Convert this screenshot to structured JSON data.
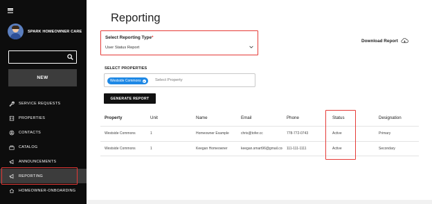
{
  "sidebar": {
    "brand_name": "SPARK HOMEOWNER CARE",
    "search_value": "",
    "new_label": "NEW",
    "items": [
      {
        "label": "SERVICE REQUESTS",
        "icon": "wrench-icon"
      },
      {
        "label": "PROPERTIES",
        "icon": "building-icon"
      },
      {
        "label": "CONTACTS",
        "icon": "contacts-icon"
      },
      {
        "label": "CATALOG",
        "icon": "catalog-icon"
      },
      {
        "label": "ANNOUNCEMENTS",
        "icon": "megaphone-icon"
      },
      {
        "label": "REPORTING",
        "icon": "megaphone-icon",
        "active": true
      },
      {
        "label": "HOMEOWNER-ONBOARDING",
        "icon": "home-icon"
      }
    ],
    "highlight_color": "#e53935"
  },
  "main": {
    "title": "Reporting",
    "report_type": {
      "label": "Select Reporting Type",
      "required_mark": "*",
      "value": "User Status Report"
    },
    "download_label": "Download Report",
    "properties": {
      "label": "SELECT PROPERTIES",
      "chip": "Westside Commons",
      "placeholder": "Select Property"
    },
    "generate_label": "GENERATE REPORT",
    "table": {
      "headers": [
        "Property",
        "Unit",
        "Name",
        "Email",
        "Phone",
        "Status",
        "Designation"
      ],
      "rows": [
        [
          "Westside Commons",
          "1",
          "Homeowner Example",
          "chris@tofer.cc",
          "778-772-0743",
          "Active",
          "Primary"
        ],
        [
          "Westside Commons",
          "1",
          "Keegan Homeowner",
          "keegan.smart96@gmail.com",
          "111-111-1111",
          "Active",
          "Secondary"
        ]
      ]
    }
  },
  "colors": {
    "sidebar_bg": "#0d0d0d",
    "chip": "#1e88e5",
    "annotation": "#e53935"
  }
}
